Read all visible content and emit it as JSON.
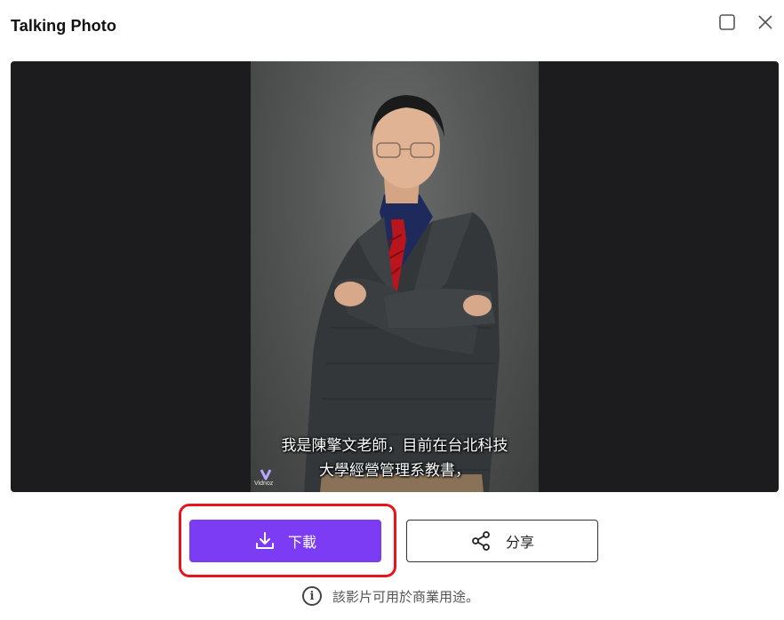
{
  "dialog": {
    "title": "Talking Photo"
  },
  "video": {
    "subtitle_line1": "我是陳擎文老師，目前在台北科技",
    "subtitle_line2": "大學經營管理系教書，",
    "watermark": "Vidnoz"
  },
  "actions": {
    "download_label": "下載",
    "share_label": "分享"
  },
  "footer": {
    "note": "該影片可用於商業用途。",
    "info_icon": "i"
  },
  "colors": {
    "accent": "#7c3cf4",
    "highlight": "#e8141b",
    "player_bg": "#1c1c1e"
  },
  "icons": {
    "maximize": "square-icon",
    "close": "close-icon",
    "download": "download-icon",
    "share": "share-icon",
    "info": "info-icon"
  }
}
